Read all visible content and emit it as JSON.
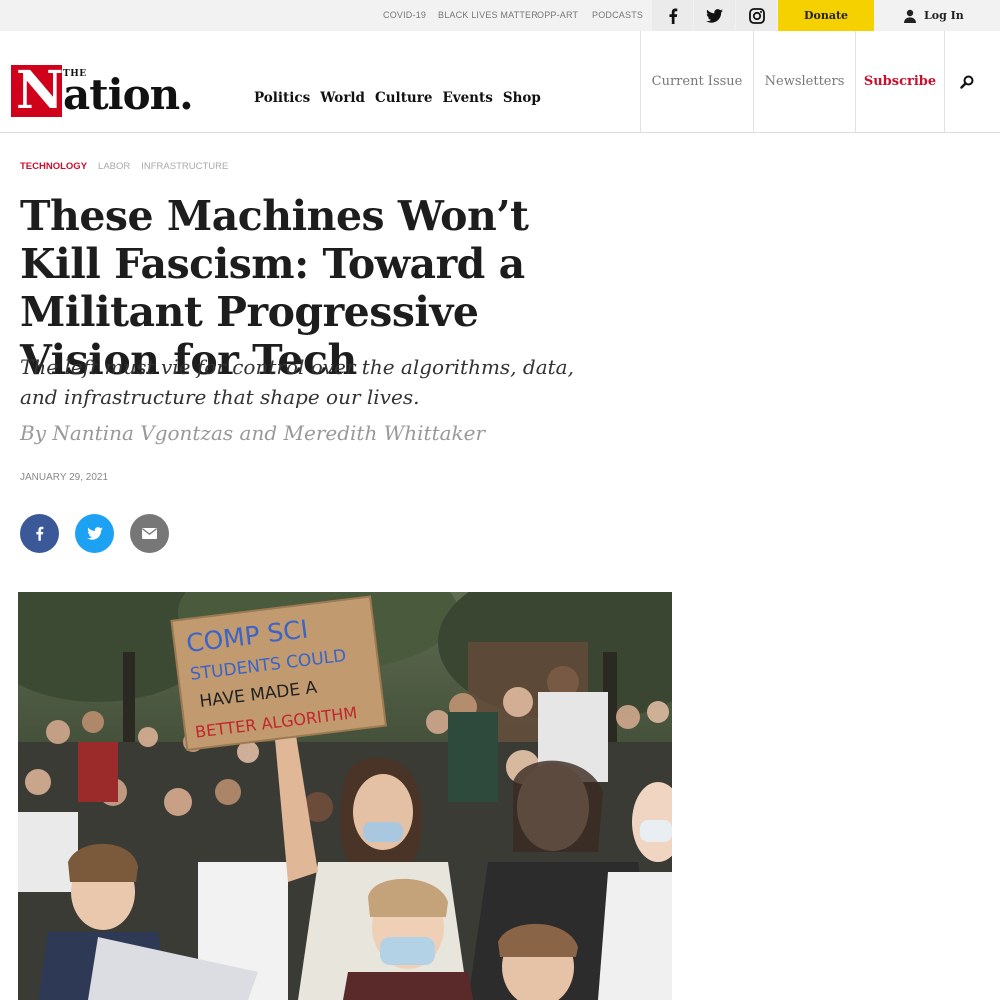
{
  "topbar": {
    "links": [
      "COVID-19",
      "BLACK LIVES MATTER",
      "OPP-ART",
      "PODCASTS"
    ],
    "social": [
      "facebook-icon",
      "twitter-icon",
      "instagram-icon"
    ],
    "donate": "Donate",
    "login": "Log In"
  },
  "logo": {
    "the": "THE",
    "n": "N",
    "word": "ation."
  },
  "nav": {
    "primary": [
      "Politics",
      "World",
      "Culture",
      "Events",
      "Shop"
    ],
    "current_issue": "Current Issue",
    "newsletters": "Newsletters",
    "subscribe": "Subscribe",
    "search_icon": "search-icon"
  },
  "article": {
    "tags": [
      "TECHNOLOGY",
      "LABOR",
      "INFRASTRUCTURE"
    ],
    "headline": "These Machines Won’t Kill Fascism: Toward a Militant Progressive Vision for Tech",
    "dek": "The left must vie for control over the algorithms, data, and infrastructure that shape our lives.",
    "byline": "By Nantina Vgontzas and Meredith Whittaker",
    "date": "JANUARY 29, 2021"
  },
  "share": [
    "facebook-icon",
    "twitter-icon",
    "email-icon"
  ],
  "hero": {
    "sign_lines": [
      "COMP SCI",
      "STUDENTS COULD",
      "HAVE MADE A",
      "BETTER ALGORITHM"
    ]
  },
  "colors": {
    "brand_red": "#d0021b",
    "donate_yellow": "#f6d100",
    "facebook": "#3b5998",
    "twitter": "#1da1f2",
    "email": "#777777"
  }
}
